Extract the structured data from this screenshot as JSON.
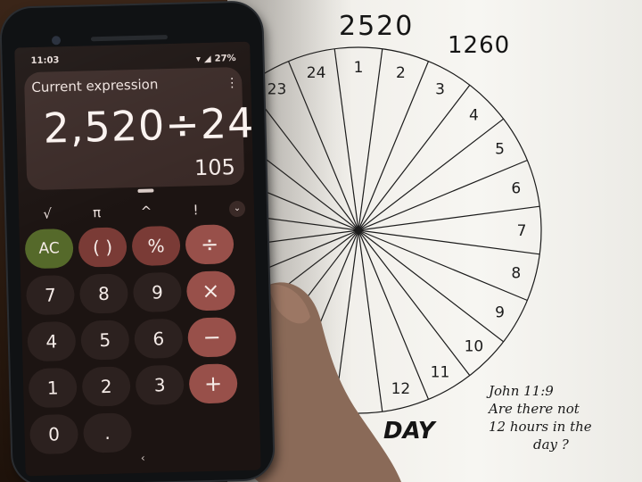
{
  "paper": {
    "top_number_left": "2520",
    "top_number_right": "1260",
    "hour_numbers": [
      "23",
      "24",
      "1",
      "2",
      "3",
      "4",
      "5",
      "6",
      "7",
      "8",
      "9",
      "10",
      "11",
      "12"
    ],
    "day_label": "DAY",
    "note_lines": [
      "John 11:9",
      "Are there not",
      "12 hours in the",
      "day ?"
    ]
  },
  "calculator": {
    "status_time": "11:03",
    "status_battery": "27%",
    "status_icons": [
      "mail-icon",
      "mail-icon",
      "alarm-icon",
      "wifi-icon",
      "signal-icon",
      "battery-icon"
    ],
    "expression_label": "Current expression",
    "expression": "2,520÷24",
    "result": "105",
    "menu_icon": "more-vertical-icon",
    "scientific_row": [
      "√",
      "π",
      "^",
      "!"
    ],
    "expand_icon": "chevron-down-icon",
    "keys": [
      {
        "label": "AC",
        "style": "ac",
        "name": "all-clear-button"
      },
      {
        "label": "( )",
        "style": "fn",
        "name": "parentheses-button"
      },
      {
        "label": "%",
        "style": "fn",
        "name": "percent-button"
      },
      {
        "label": "÷",
        "style": "op",
        "name": "divide-button"
      },
      {
        "label": "7",
        "style": "num",
        "name": "digit-7-button"
      },
      {
        "label": "8",
        "style": "num",
        "name": "digit-8-button"
      },
      {
        "label": "9",
        "style": "num",
        "name": "digit-9-button"
      },
      {
        "label": "×",
        "style": "op",
        "name": "multiply-button"
      },
      {
        "label": "4",
        "style": "num",
        "name": "digit-4-button"
      },
      {
        "label": "5",
        "style": "num",
        "name": "digit-5-button"
      },
      {
        "label": "6",
        "style": "num",
        "name": "digit-6-button"
      },
      {
        "label": "−",
        "style": "op",
        "name": "subtract-button"
      },
      {
        "label": "1",
        "style": "num",
        "name": "digit-1-button"
      },
      {
        "label": "2",
        "style": "num",
        "name": "digit-2-button"
      },
      {
        "label": "3",
        "style": "num",
        "name": "digit-3-button"
      },
      {
        "label": "+",
        "style": "op",
        "name": "add-button"
      },
      {
        "label": "0",
        "style": "num",
        "name": "digit-0-button"
      },
      {
        "label": ".",
        "style": "num",
        "name": "decimal-button"
      }
    ],
    "nav_back": "‹",
    "colors": {
      "screen_bg": "#1c1412",
      "display_card": "#3a2a27",
      "ac_key": "#55692a",
      "function_key": "#7a3b36",
      "operator_key": "#98504a",
      "number_key": "#2c211f"
    }
  }
}
